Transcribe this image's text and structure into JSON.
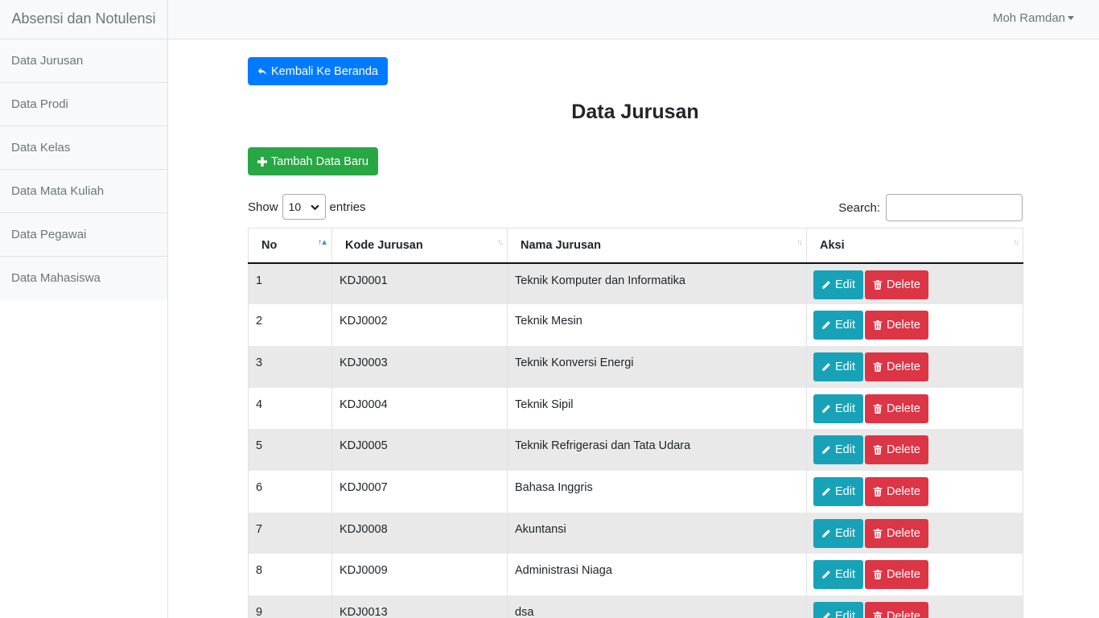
{
  "navbar": {
    "brand": "Absensi dan Notulensi",
    "user": "Moh Ramdan"
  },
  "sidebar": {
    "items": [
      {
        "label": "Data Jurusan"
      },
      {
        "label": "Data Prodi"
      },
      {
        "label": "Data Kelas"
      },
      {
        "label": "Data Mata Kuliah"
      },
      {
        "label": "Data Pegawai"
      },
      {
        "label": "Data Mahasiswa"
      }
    ]
  },
  "main": {
    "back_label": "Kembali Ke Beranda",
    "title": "Data Jurusan",
    "add_label": "Tambah Data Baru",
    "show_label": "Show",
    "entries_value": "10",
    "entries_label": "entries",
    "search_label": "Search:",
    "search_value": ""
  },
  "table": {
    "headers": [
      "No",
      "Kode Jurusan",
      "Nama Jurusan",
      "Aksi"
    ],
    "edit_label": "Edit",
    "delete_label": "Delete",
    "rows": [
      {
        "no": "1",
        "kode": "KDJ0001",
        "nama": "Teknik Komputer dan Informatika"
      },
      {
        "no": "2",
        "kode": "KDJ0002",
        "nama": "Teknik Mesin"
      },
      {
        "no": "3",
        "kode": "KDJ0003",
        "nama": "Teknik Konversi Energi"
      },
      {
        "no": "4",
        "kode": "KDJ0004",
        "nama": "Teknik Sipil"
      },
      {
        "no": "5",
        "kode": "KDJ0005",
        "nama": "Teknik Refrigerasi dan Tata Udara"
      },
      {
        "no": "6",
        "kode": "KDJ0007",
        "nama": "Bahasa Inggris"
      },
      {
        "no": "7",
        "kode": "KDJ0008",
        "nama": "Akuntansi"
      },
      {
        "no": "8",
        "kode": "KDJ0009",
        "nama": "Administrasi Niaga"
      },
      {
        "no": "9",
        "kode": "KDJ0013",
        "nama": "dsa"
      }
    ]
  },
  "colors": {
    "primary": "#007bff",
    "success": "#28a745",
    "info": "#17a2b8",
    "danger": "#dc3545"
  }
}
